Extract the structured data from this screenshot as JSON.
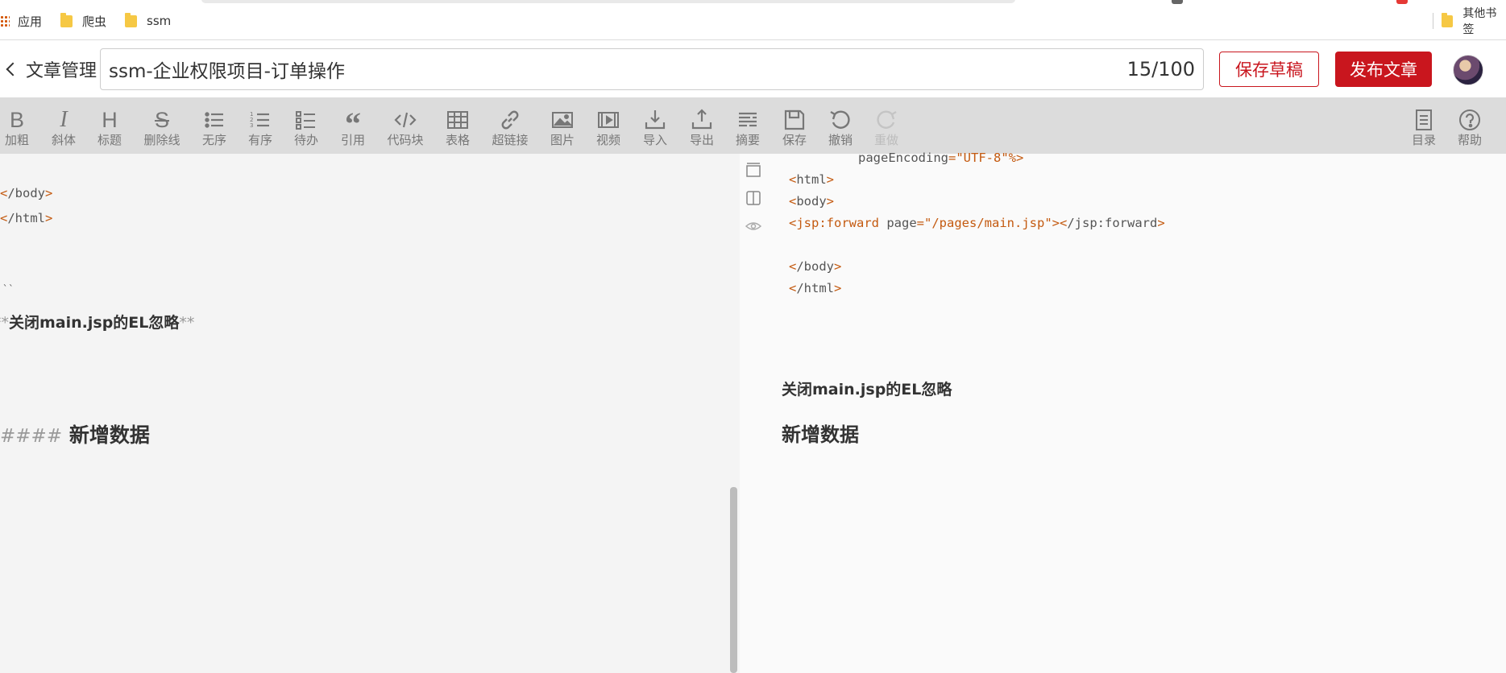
{
  "bookmarks": {
    "items": [
      {
        "label": "应用",
        "icon": "apps-grid-icon"
      },
      {
        "label": "爬虫",
        "icon": "folder-icon"
      },
      {
        "label": "ssm",
        "icon": "folder-icon"
      }
    ],
    "other": {
      "label": "其他书签",
      "icon": "folder-icon"
    }
  },
  "header": {
    "back_label": "文章管理",
    "title_value": "ssm-企业权限项目-订单操作",
    "title_count": "15/100",
    "save_draft_label": "保存草稿",
    "publish_label": "发布文章",
    "brand_color": "#c9161e"
  },
  "toolbar": {
    "items": [
      {
        "label": "加粗",
        "icon": "bold-icon"
      },
      {
        "label": "斜体",
        "icon": "italic-icon"
      },
      {
        "label": "标题",
        "icon": "heading-icon"
      },
      {
        "label": "删除线",
        "icon": "strikethrough-icon"
      },
      {
        "label": "无序",
        "icon": "unordered-list-icon"
      },
      {
        "label": "有序",
        "icon": "ordered-list-icon"
      },
      {
        "label": "待办",
        "icon": "todo-list-icon"
      },
      {
        "label": "引用",
        "icon": "quote-icon"
      },
      {
        "label": "代码块",
        "icon": "code-block-icon"
      },
      {
        "label": "表格",
        "icon": "table-icon"
      },
      {
        "label": "超链接",
        "icon": "link-icon"
      },
      {
        "label": "图片",
        "icon": "image-icon"
      },
      {
        "label": "视频",
        "icon": "video-icon"
      },
      {
        "label": "导入",
        "icon": "import-icon"
      },
      {
        "label": "导出",
        "icon": "export-icon"
      },
      {
        "label": "摘要",
        "icon": "summary-icon"
      },
      {
        "label": "保存",
        "icon": "save-icon"
      },
      {
        "label": "撤销",
        "icon": "undo-icon"
      },
      {
        "label": "重做",
        "icon": "redo-icon",
        "disabled": true
      }
    ],
    "right": [
      {
        "label": "目录",
        "icon": "toc-icon"
      },
      {
        "label": "帮助",
        "icon": "help-icon"
      }
    ]
  },
  "editor": {
    "line_body_close": "/body",
    "line_html_close": "/html",
    "fence": "``",
    "bold_marker": "**",
    "bold_text": "关闭main.jsp的EL忽略",
    "h4_marker": "####",
    "h4_text": "新增数据"
  },
  "preview": {
    "code_lines": {
      "encoding_attr": "pageEncoding",
      "encoding_val": "\"UTF-8\"",
      "encoding_end": "%>",
      "html_open": "html",
      "body_open": "body",
      "forward_tag": "jsp:forward",
      "forward_attr": "page",
      "forward_val": "\"/pages/main.jsp\"",
      "forward_close": "/jsp:forward",
      "body_close": "/body",
      "html_close": "/html"
    },
    "bold_text": "关闭main.jsp的EL忽略",
    "h4_text": "新增数据"
  }
}
